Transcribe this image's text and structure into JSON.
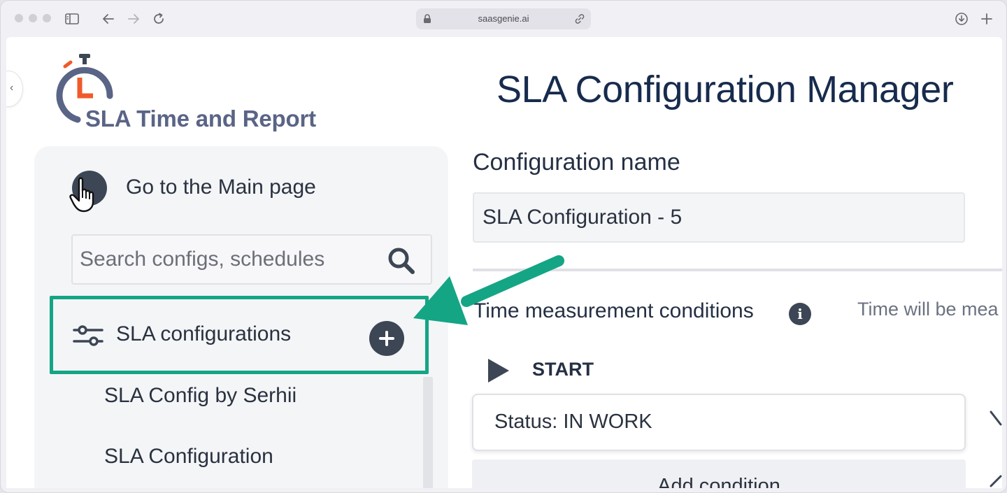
{
  "browser": {
    "url": "saasgenie.ai",
    "icons": [
      "sidebar-toggle-icon",
      "back-arrow-icon",
      "forward-arrow-icon",
      "reload-icon",
      "lock-icon",
      "link-icon",
      "download-icon",
      "new-tab-plus-icon"
    ]
  },
  "app": {
    "logo_text": "SLA Time and Report",
    "page_title": "SLA Configuration Manager"
  },
  "sidebar": {
    "goto_label": "Go to the Main page",
    "search_placeholder": "Search configs, schedules",
    "section_label": "SLA configurations",
    "items": [
      {
        "label": "SLA Config by Serhii"
      },
      {
        "label": "SLA Configuration"
      }
    ]
  },
  "main": {
    "config_name_heading": "Configuration name",
    "config_name_value": "SLA Configuration - 5",
    "time_conditions_heading": "Time measurement conditions",
    "time_conditions_hint": "Time will be mea",
    "start_label": "START",
    "status_condition": "Status: IN WORK",
    "add_condition_label": "Add condition"
  },
  "colors": {
    "accent_highlight": "#14a585",
    "logo_red": "#f05a2a",
    "navy": "#3c4654",
    "heading": "#172b4d"
  }
}
